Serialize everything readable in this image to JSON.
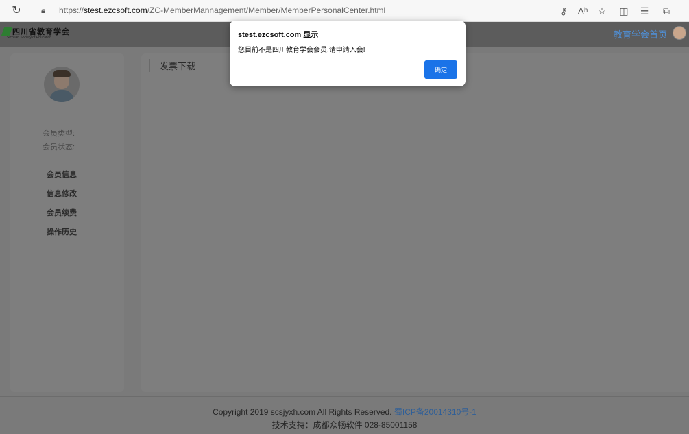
{
  "browser": {
    "reload_icon": "reload-icon",
    "lock_icon": "lock-icon",
    "url_prefix": "https://",
    "url_host": "stest.ezcsoft.com",
    "url_path": "/ZC-MemberMannagement/Member/MemberPersonalCenter.html",
    "toolbar_icons": [
      "key-icon",
      "read-aloud-icon",
      "favorite-star-icon",
      "split-screen-icon",
      "favorites-list-icon",
      "collections-icon"
    ]
  },
  "header": {
    "logo_cn": "四川省教育学会",
    "logo_en": "Sichuan Society of Education",
    "home_link": "教育学会首页"
  },
  "sidebar": {
    "member_type_label": "会员类型:",
    "member_status_label": "会员状态:",
    "menu": [
      "会员信息",
      "信息修改",
      "会员续费",
      "操作历史"
    ]
  },
  "content": {
    "title": "发票下载"
  },
  "footer": {
    "copyright": "Copyright 2019 scsjyxh.com All Rights Reserved.",
    "icp": "蜀ICP备20014310号-1",
    "support": "技术支持：成都众畅软件 028-85001158"
  },
  "dialog": {
    "title": "stest.ezcsoft.com 显示",
    "message": "您目前不是四川教育学会会员,请申请入会!",
    "ok_label": "确定"
  },
  "colors": {
    "accent": "#1a73e8",
    "link": "#4f8fd6",
    "overlay": "#7a7a7a"
  }
}
